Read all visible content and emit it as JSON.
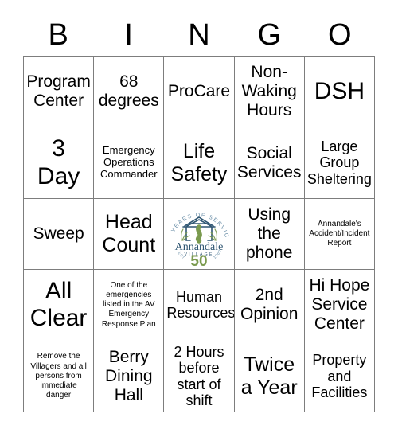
{
  "header": {
    "letters": [
      "B",
      "I",
      "N",
      "G",
      "O"
    ]
  },
  "grid": {
    "rows": [
      [
        {
          "text": "Program\nCenter",
          "size": "fs-l"
        },
        {
          "text": "68\ndegrees",
          "size": "fs-l"
        },
        {
          "text": "ProCare",
          "size": "fs-l"
        },
        {
          "text": "Non-\nWaking\nHours",
          "size": "fs-l"
        },
        {
          "text": "DSH",
          "size": "fs-xxl"
        }
      ],
      [
        {
          "text": "3\nDay",
          "size": "fs-xxl"
        },
        {
          "text": "Emergency\nOperations\nCommander",
          "size": "fs-s"
        },
        {
          "text": "Life\nSafety",
          "size": "fs-xl"
        },
        {
          "text": "Social\nServices",
          "size": "fs-l"
        },
        {
          "text": "Large\nGroup\nSheltering",
          "size": "fs-m"
        }
      ],
      [
        {
          "text": "Sweep",
          "size": "fs-l"
        },
        {
          "text": "Head\nCount",
          "size": "fs-xl"
        },
        {
          "text": "",
          "size": "logo"
        },
        {
          "text": "Using\nthe\nphone",
          "size": "fs-l"
        },
        {
          "text": "Annandale's\nAccident/Incident\nReport",
          "size": "fs-xs"
        }
      ],
      [
        {
          "text": "All\nClear",
          "size": "fs-xxl"
        },
        {
          "text": "One of the\nemergencies\nlisted in the AV\nEmergency\nResponse Plan",
          "size": "fs-xs"
        },
        {
          "text": "Human\nResources",
          "size": "fs-m"
        },
        {
          "text": "2nd\nOpinion",
          "size": "fs-l"
        },
        {
          "text": "Hi Hope\nService\nCenter",
          "size": "fs-l"
        }
      ],
      [
        {
          "text": "Remove the\nVillagers and all\npersons from\nimmediate\ndanger",
          "size": "fs-xs"
        },
        {
          "text": "Berry\nDining\nHall",
          "size": "fs-l"
        },
        {
          "text": "2 Hours\nbefore\nstart of\nshift",
          "size": "fs-m"
        },
        {
          "text": "Twice\na Year",
          "size": "fs-xl"
        },
        {
          "text": "Property\nand\nFacilities",
          "size": "fs-m"
        }
      ]
    ]
  },
  "logo": {
    "name": "annandale-village-logo",
    "arc_top_text": "50 YEARS OF SERVICE",
    "wordmark": "Annandale",
    "subtitle": "VILLAGE",
    "arc_left_text": "EST.",
    "arc_right_text": "1969",
    "anniversary_number": "50",
    "colors": {
      "navy": "#2e5571",
      "green": "#7a9a4e",
      "light_blue": "#6b8fa8"
    }
  },
  "colors": {
    "grid_line": "#7d7d7d",
    "text": "#000000",
    "background": "#ffffff"
  }
}
